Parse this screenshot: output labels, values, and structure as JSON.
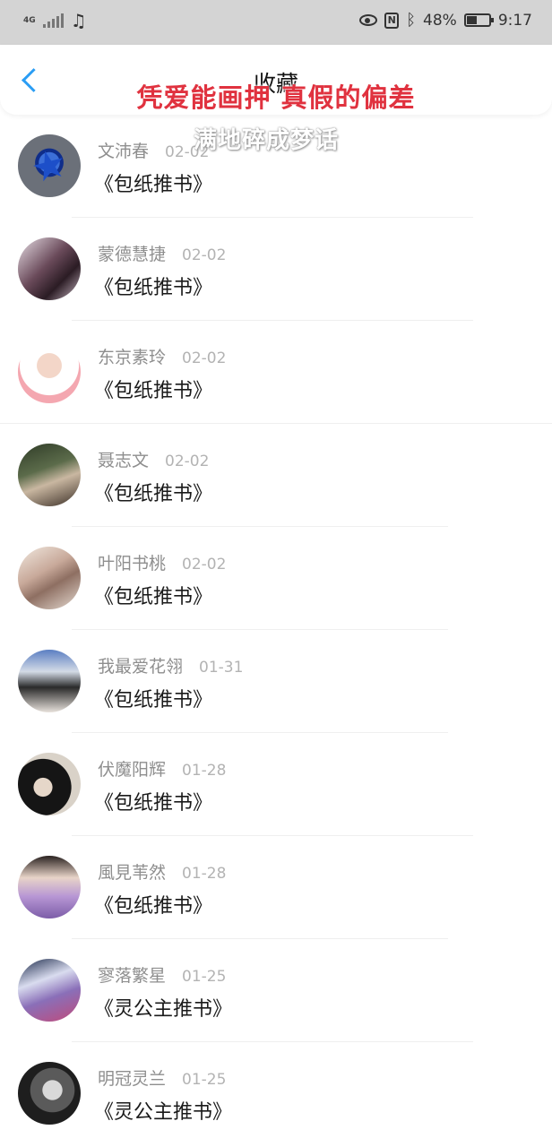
{
  "status_bar": {
    "network": "4G",
    "battery_percent": "48%",
    "battery_level": 0.48,
    "time": "9:17",
    "icons": [
      "music-note-icon",
      "eye-icon",
      "nfc-icon",
      "bluetooth-icon",
      "battery-icon"
    ]
  },
  "header": {
    "title": "收藏",
    "overlay_line1": "凭爱能画押 真假的偏差",
    "overlay_line2": "满地碎成梦话"
  },
  "colors": {
    "accent": "#2a9df4",
    "overlay_red": "#e0323f"
  },
  "items": [
    {
      "name": "文沛春",
      "date": "02-02",
      "title": "《包纸推书》",
      "avatar_desc": "blue-star-avatar"
    },
    {
      "name": "蒙德慧捷",
      "date": "02-02",
      "title": "《包纸推书》",
      "avatar_desc": "anime-figure-avatar"
    },
    {
      "name": "东京素玲",
      "date": "02-02",
      "title": "《包纸推书》",
      "avatar_desc": "chibi-hearts-avatar"
    },
    {
      "name": "聂志文",
      "date": "02-02",
      "title": "《包纸推书》",
      "avatar_desc": "couple-photo-avatar"
    },
    {
      "name": "叶阳书桃",
      "date": "02-02",
      "title": "《包纸推书》",
      "avatar_desc": "anime-girl-avatar"
    },
    {
      "name": "我最爱花翎",
      "date": "01-31",
      "title": "《包纸推书》",
      "avatar_desc": "man-photo-avatar"
    },
    {
      "name": "伏魔阳辉",
      "date": "01-28",
      "title": "《包纸推书》",
      "avatar_desc": "hooded-figure-avatar"
    },
    {
      "name": "風見苇然",
      "date": "01-28",
      "title": "《包纸推书》",
      "avatar_desc": "woman-flowers-avatar"
    },
    {
      "name": "寥落繁星",
      "date": "01-25",
      "title": "《灵公主推书》",
      "avatar_desc": "silver-hair-anime-avatar"
    },
    {
      "name": "明冠灵兰",
      "date": "01-25",
      "title": "《灵公主推书》",
      "avatar_desc": "bw-portrait-avatar"
    }
  ]
}
